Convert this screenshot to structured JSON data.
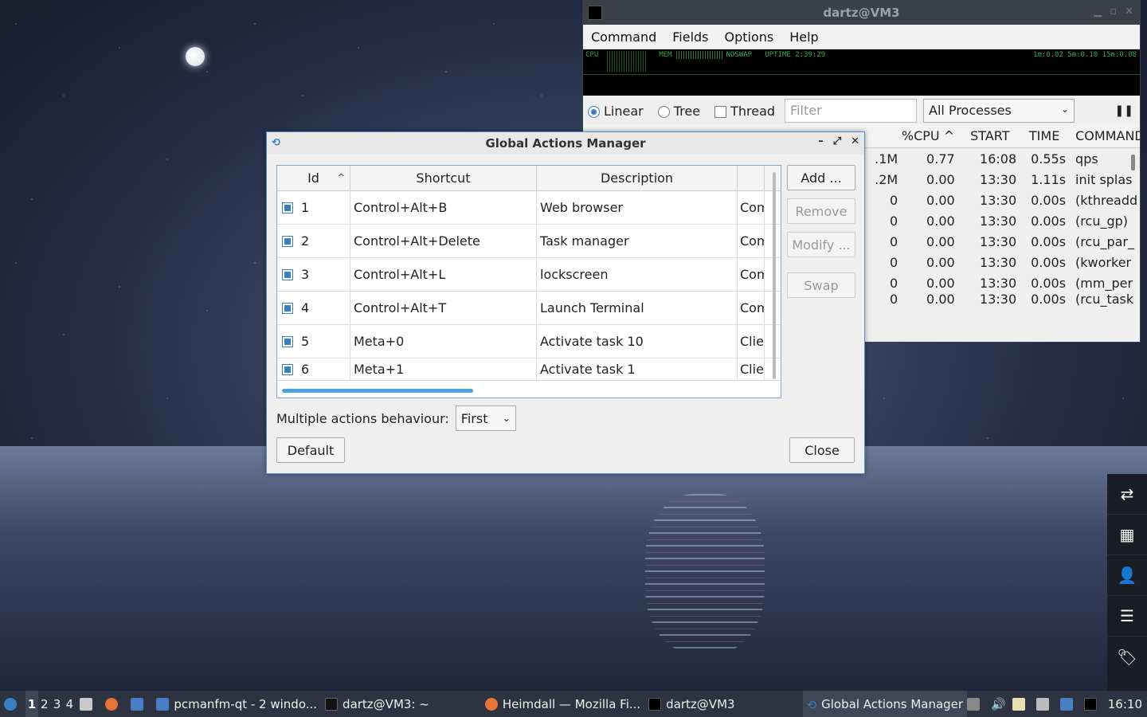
{
  "qps": {
    "title": "dartz@VM3",
    "menu": [
      "Command",
      "Fields",
      "Options",
      "Help"
    ],
    "graph": {
      "cpu": "CPU",
      "mem": "MEM",
      "noswap": "NOSWAP",
      "uptime": "UPTIME 2:39:29",
      "load": "1m:0.02 5m:0.10 15m:0.08"
    },
    "modes": {
      "linear": "Linear",
      "tree": "Tree",
      "thread": "Thread"
    },
    "filter_placeholder": "Filter",
    "process_filter": "All Processes",
    "columns": {
      "cpu": "%CPU",
      "start": "START",
      "time": "TIME",
      "command": "COMMAND"
    },
    "rows": [
      {
        "mem": ".1M",
        "cpu": "0.77",
        "start": "16:08",
        "time": "0.55s",
        "cmd": "qps"
      },
      {
        "mem": ".2M",
        "cpu": "0.00",
        "start": "13:30",
        "time": "1.11s",
        "cmd": "init splas"
      },
      {
        "mem": "0",
        "cpu": "0.00",
        "start": "13:30",
        "time": "0.00s",
        "cmd": "(kthreadd"
      },
      {
        "mem": "0",
        "cpu": "0.00",
        "start": "13:30",
        "time": "0.00s",
        "cmd": "(rcu_gp)"
      },
      {
        "mem": "0",
        "cpu": "0.00",
        "start": "13:30",
        "time": "0.00s",
        "cmd": "(rcu_par_"
      },
      {
        "mem": "0",
        "cpu": "0.00",
        "start": "13:30",
        "time": "0.00s",
        "cmd": "(kworker"
      },
      {
        "mem": "0",
        "cpu": "0.00",
        "start": "13:30",
        "time": "0.00s",
        "cmd": "(mm_per"
      },
      {
        "mem": "0",
        "cpu": "0.00",
        "start": "13:30",
        "time": "0.00s",
        "cmd": "(rcu_task"
      }
    ]
  },
  "dialog": {
    "title": "Global Actions Manager",
    "columns": {
      "id": "Id",
      "shortcut": "Shortcut",
      "description": "Description"
    },
    "rows": [
      {
        "id": "1",
        "shortcut": "Control+Alt+B",
        "description": "Web browser",
        "action": "Com"
      },
      {
        "id": "2",
        "shortcut": "Control+Alt+Delete",
        "description": "Task manager",
        "action": "Com"
      },
      {
        "id": "3",
        "shortcut": "Control+Alt+L",
        "description": "lockscreen",
        "action": "Com"
      },
      {
        "id": "4",
        "shortcut": "Control+Alt+T",
        "description": "Launch Terminal",
        "action": "Com"
      },
      {
        "id": "5",
        "shortcut": "Meta+0",
        "description": "Activate task 10",
        "action": "Clie"
      },
      {
        "id": "6",
        "shortcut": "Meta+1",
        "description": "Activate task 1",
        "action": "Clie"
      }
    ],
    "buttons": {
      "add": "Add ...",
      "remove": "Remove",
      "modify": "Modify ...",
      "swap": "Swap",
      "default": "Default",
      "close": "Close"
    },
    "multiple_label": "Multiple actions behaviour:",
    "multiple_value": "First"
  },
  "taskbar": {
    "workspaces": [
      "1",
      "2",
      "3",
      "4"
    ],
    "windows": [
      "pcmanfm-qt - 2 windo...",
      "dartz@VM3: ~",
      "Heimdall — Mozilla Fi...",
      "dartz@VM3",
      "Global Actions Manager"
    ],
    "clock": "16:10"
  },
  "side_icons": [
    "switch-icon",
    "grid-icon",
    "user-icon",
    "list-icon",
    "tag-icon"
  ]
}
